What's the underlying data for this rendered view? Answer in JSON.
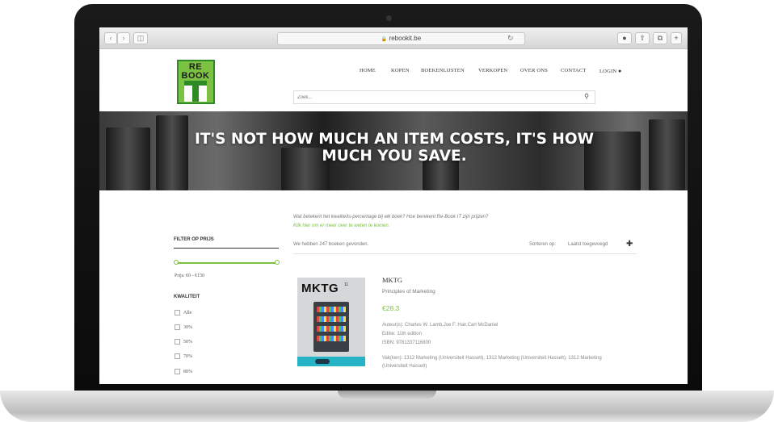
{
  "browser": {
    "url": "rebookit.be",
    "back_icon": "chevron-left-icon",
    "forward_icon": "chevron-right-icon",
    "sidebar_icon": "sidebar-icon",
    "lock_icon": "lock-icon",
    "reload_icon": "reload-icon"
  },
  "logo": {
    "top_text": "RE BOOK"
  },
  "nav": {
    "items": [
      "HOME",
      "KOPEN",
      "BOEKENLIJSTEN",
      "VERKOPEN",
      "OVER ONS",
      "CONTACT",
      "LOGIN"
    ]
  },
  "search": {
    "placeholder": "Zoek..."
  },
  "hero": {
    "tagline": "IT'S NOT HOW MUCH AN ITEM COSTS, IT'S HOW MUCH YOU SAVE."
  },
  "sidebar": {
    "price_filter_title": "FILTER OP PRIJS",
    "price_range_text": "Prijs: €0 - €150",
    "quality_title": "KWALITEIT",
    "quality_options": [
      "Alle",
      "30%",
      "50%",
      "70%",
      "80%"
    ]
  },
  "main": {
    "info_question": "Wat betekent het kwaliteits-percentage bij elk boek? Hoe berekent Re-Book IT zijn prijzen?",
    "info_link": "Klik hier om er meer over te weten te komen.",
    "results_count": "We hebben 247 boeken gevonden.",
    "sort_label": "Sorteren op:",
    "sort_value": "Laatst toegevoegd"
  },
  "product": {
    "cover_title": "MKTG",
    "cover_edition": "11",
    "title": "MKTG",
    "subtitle": "Principles of Marketing",
    "price": "€28.3",
    "authors": "Auteur(s): Charles W. Lamb,Joe F. Hair,Carl McDaniel",
    "edition": "Editie: 11th edition",
    "isbn": "ISBN: 9781337116800",
    "vakken": "Vak(ken): 1312 Marketing (Universiteit Hasselt), 1312 Marketing (Universiteit Hasselt), 1312 Marketing (Universiteit Hasselt)"
  },
  "colors": {
    "accent": "#7cc242",
    "logo_dark": "#2d8a25",
    "cover_band": "#25b3c5"
  }
}
